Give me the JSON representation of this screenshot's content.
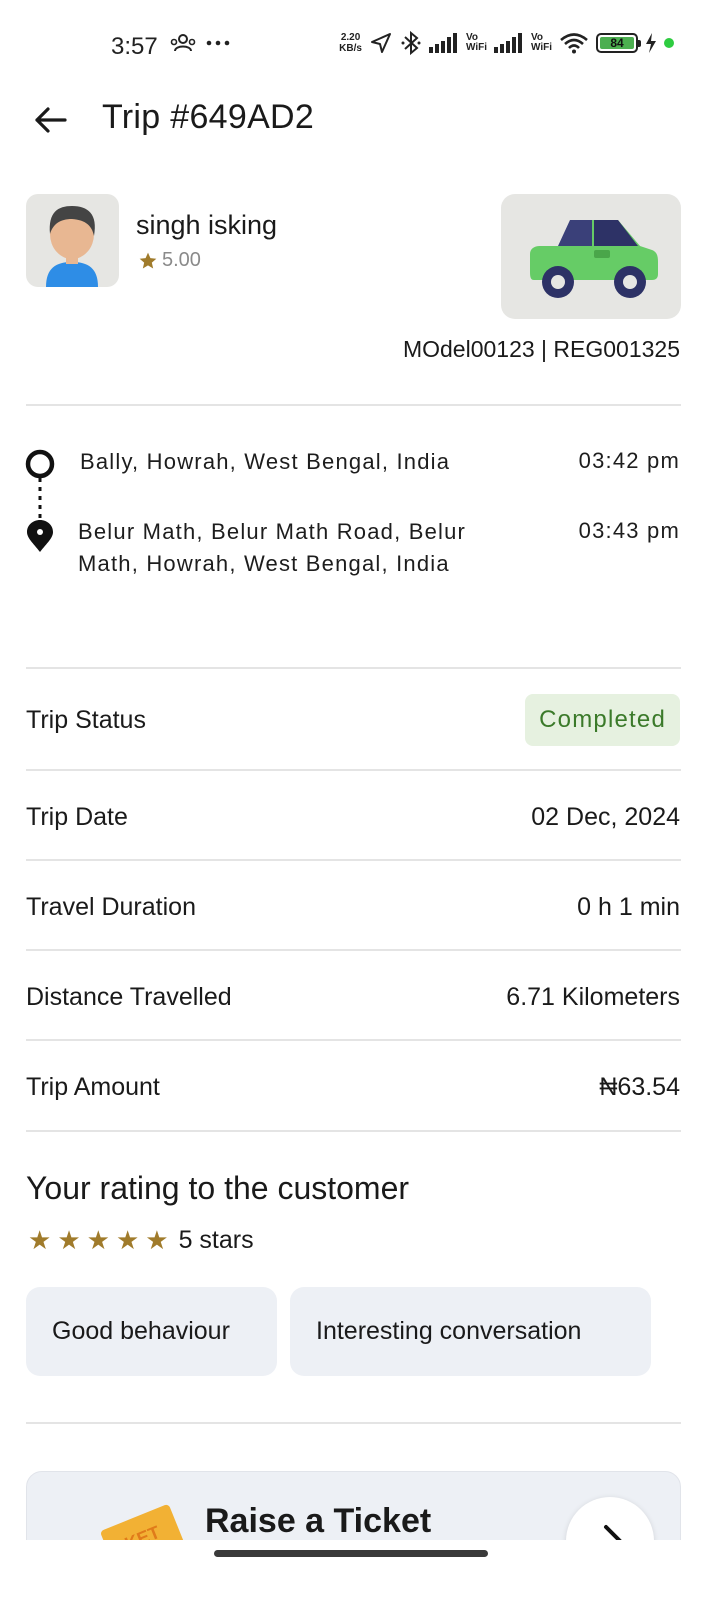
{
  "status_bar": {
    "time": "3:57",
    "net_speed_value": "2.20",
    "net_speed_unit": "KB/s",
    "vowifi_1": "Vo",
    "vowifi_1b": "WiFi",
    "vowifi_2": "Vo",
    "vowifi_2b": "WiFi",
    "battery_level": "84",
    "battery_color": "#4caf50"
  },
  "header": {
    "title": "Trip #649AD2"
  },
  "driver": {
    "name": "singh isking",
    "rating": "5.00",
    "vehicle": "MOdel00123 | REG001325"
  },
  "route": {
    "pickup": {
      "address": "Bally, Howrah, West Bengal, India",
      "time": "03:42 pm"
    },
    "dropoff": {
      "address_line1": "Belur Math, Belur Math Road, Belur",
      "address_line2": "Math, Howrah, West Bengal, India",
      "time": "03:43 pm"
    }
  },
  "details": {
    "status_label": "Trip Status",
    "status_value": "Completed",
    "status_color": "#3b7a2a",
    "date_label": "Trip Date",
    "date_value": "02 Dec, 2024",
    "duration_label": "Travel Duration",
    "duration_value": "0 h 1 min",
    "distance_label": "Distance Travelled",
    "distance_value": "6.71 Kilometers",
    "amount_label": "Trip Amount",
    "amount_value": "₦63.54"
  },
  "customer_rating": {
    "title": "Your rating to the customer",
    "stars": 5,
    "stars_text": "5 stars",
    "star_color": "#a07b2b",
    "tags": [
      "Good behaviour",
      "Interesting conversation"
    ]
  },
  "ticket": {
    "title": "Raise a Ticket",
    "image_label": "KET"
  },
  "icons": {
    "back": "arrow-left-icon",
    "star": "star-icon",
    "car": "car-icon",
    "pickup": "origin-circle-icon",
    "dropoff": "destination-pin-icon"
  }
}
